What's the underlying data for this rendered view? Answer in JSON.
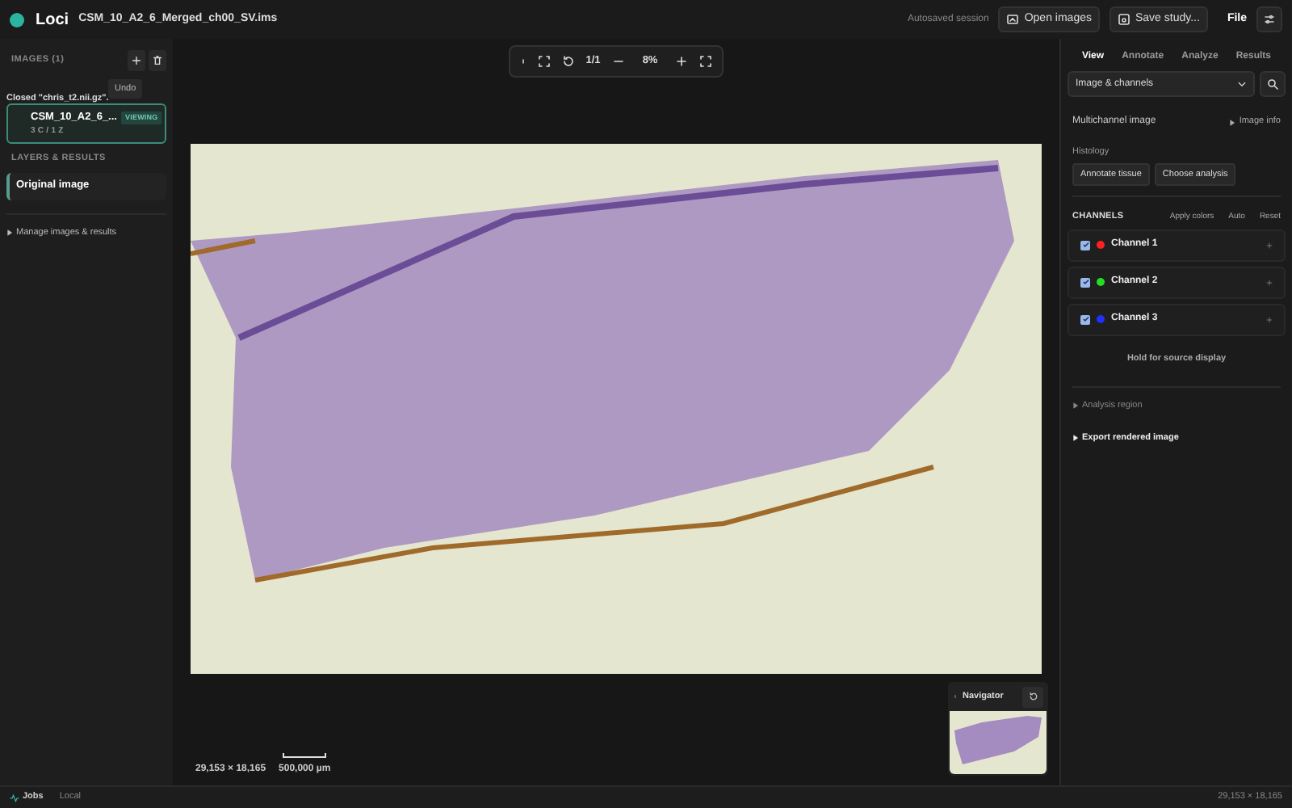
{
  "header": {
    "app_name": "Loci",
    "file_title": "CSM_10_A2_6_Merged_ch00_SV.ims",
    "autosave": "Autosaved session",
    "buttons": [
      {
        "kind": "open",
        "label": "Open images"
      },
      {
        "kind": "save",
        "label": "Save study..."
      }
    ],
    "menu": "File"
  },
  "sidebar": {
    "images_header": "IMAGES (1)",
    "notice": "Closed \"chris_t2.nii.gz\".",
    "tooltip": "Undo",
    "images": [
      {
        "name": "CSM_10_A2_6_...",
        "badge": "VIEWING",
        "meta": "3 C / 1 Z",
        "selected": true
      }
    ],
    "layers_header": "LAYERS & RESULTS",
    "layers": [
      {
        "label": "Original image",
        "selected": true
      }
    ],
    "manage": "Manage images & results"
  },
  "toolbar": {
    "page": "1/1",
    "zoom": "8%"
  },
  "viewer": {
    "dimensions": "29,153 × 18,165",
    "scale": "500,000 µm",
    "navigator": "Navigator"
  },
  "panel": {
    "tabs": [
      {
        "label": "View",
        "selected": true
      },
      {
        "label": "Annotate",
        "selected": false
      },
      {
        "label": "Analyze",
        "selected": false
      },
      {
        "label": "Results",
        "selected": false
      }
    ],
    "dropdown": "Image & channels",
    "section": "Multichannel image",
    "info_link": "Image info",
    "histology": "Histology",
    "histology_buttons": [
      "Annotate tissue",
      "Choose analysis"
    ],
    "channels_header": "CHANNELS",
    "channel_actions": [
      "Apply colors",
      "Auto",
      "Reset"
    ],
    "channels": [
      {
        "name": "Channel 1",
        "checked": true,
        "color": "#ff2020"
      },
      {
        "name": "Channel 2",
        "checked": true,
        "color": "#20e020"
      },
      {
        "name": "Channel 3",
        "checked": true,
        "color": "#2030ff"
      }
    ],
    "hint": "Hold for source display",
    "sections": [
      {
        "label": "Analysis region",
        "disabled": true
      },
      {
        "label": "Export rendered image",
        "disabled": false
      }
    ]
  },
  "status_bar": {
    "jobs": "Jobs",
    "mode": "Local",
    "dimensions": "29,153 × 18,165"
  }
}
